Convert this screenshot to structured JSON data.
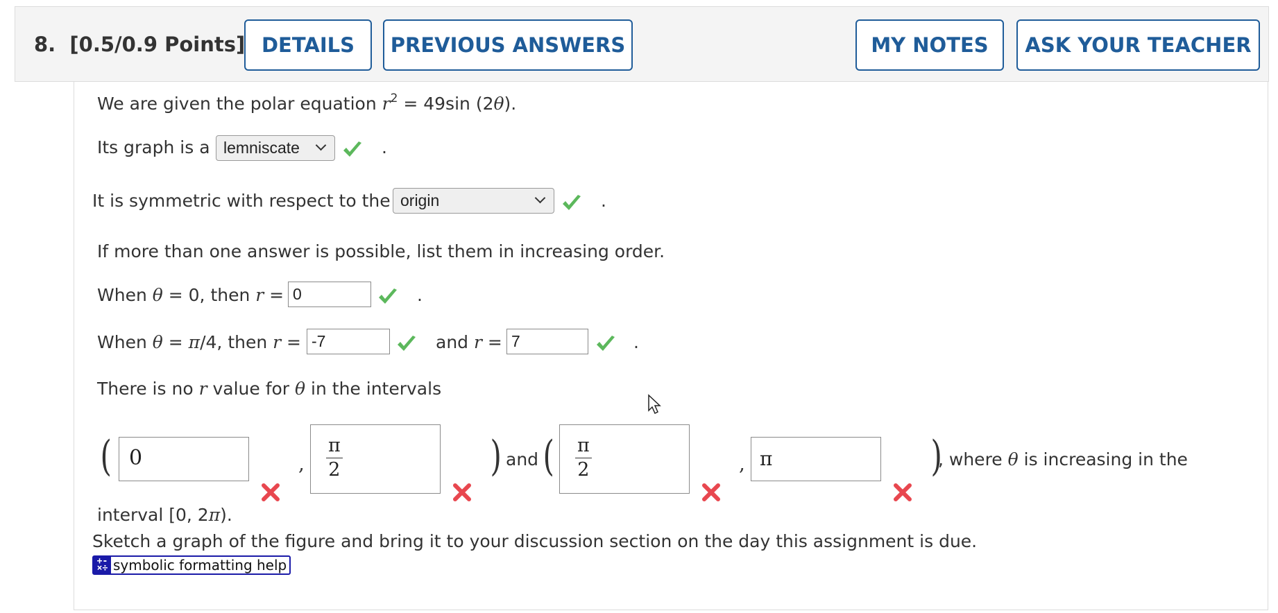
{
  "header": {
    "question_number": "8.",
    "points": "[0.5/0.9 Points]",
    "buttons": {
      "details": "DETAILS",
      "previous_answers": "PREVIOUS ANSWERS",
      "my_notes": "MY NOTES",
      "ask_teacher": "ASK YOUR TEACHER"
    }
  },
  "question": {
    "intro_prefix": "We are given the polar equation ",
    "intro_r": "r",
    "intro_exp": "2",
    "intro_rhs": " = 49sin (2",
    "intro_theta": "θ",
    "intro_end": ").",
    "graph_prefix": "Its graph is a",
    "graph_select": "lemniscate",
    "graph_end": ".",
    "symmetry_prefix": "It is symmetric with respect to the",
    "symmetry_select": "origin",
    "symmetry_end": ".",
    "instruction": "If more than one answer is possible, list them in increasing order.",
    "when0": {
      "prefix": "When ",
      "theta": "θ",
      "mid": " = 0, then ",
      "r": "r",
      "eq": " =",
      "value": "0",
      "end": "."
    },
    "whenpi4": {
      "prefix": "When ",
      "theta": "θ",
      "mid": " = ",
      "pi": "π",
      "mid2": "/4, then ",
      "r": "r",
      "eq": " =",
      "value1": "-7",
      "and": "and ",
      "r2": "r",
      "eq2": " =",
      "value2": "7",
      "end": "."
    },
    "no_r_prefix": "There is no ",
    "no_r_r": "r",
    "no_r_mid": " value for ",
    "no_r_theta": "θ",
    "no_r_end": " in the intervals",
    "intervals": {
      "open1": "(",
      "box1": "0",
      "comma1": ",",
      "box2_num": "π",
      "box2_den": "2",
      "close1": ")",
      "and": "and",
      "open2": "(",
      "box3_num": "π",
      "box3_den": "2",
      "comma2": ",",
      "box4": "π",
      "close2": ")",
      "tail_prefix": ", where ",
      "tail_theta": "θ",
      "tail_end": " is increasing in the"
    },
    "interval_line_prefix": "interval [0, 2",
    "interval_line_pi": "π",
    "interval_line_end": ").",
    "sketch": "Sketch a graph of the figure and bring it to your discussion section on the day this assignment is due.",
    "help_label": "symbolic formatting help"
  },
  "colors": {
    "accent": "#1f5c99",
    "correct": "#5cb85c",
    "incorrect": "#e8474f",
    "help": "#1a1aa8"
  }
}
